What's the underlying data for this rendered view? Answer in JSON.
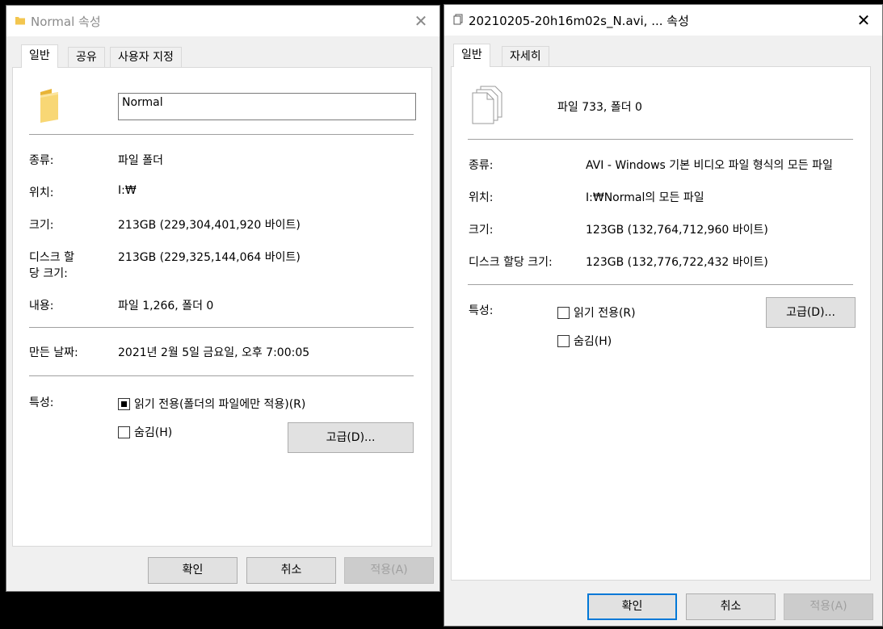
{
  "dialog1": {
    "title": "Normal 속성",
    "close_glyph": "✕",
    "tabs": [
      "일반",
      "공유",
      "사용자 지정"
    ],
    "name_value": "Normal",
    "rows": {
      "type_label": "종류:",
      "type_value": "파일 폴더",
      "location_label": "위치:",
      "location_value": "I:₩",
      "size_label": "크기:",
      "size_value": "213GB (229,304,401,920 바이트)",
      "disk_label_line1": "디스크 할",
      "disk_label_line2": "당 크기:",
      "disk_value": "213GB (229,325,144,064 바이트)",
      "contains_label": "내용:",
      "contains_value": "파일 1,266, 폴더 0",
      "created_label": "만든 날짜:",
      "created_value": "2021년 2월 5일 금요일, 오후 7:00:05",
      "attributes_label": "특성:"
    },
    "readonly_label": "읽기 전용(폴더의 파일에만 적용)(R)",
    "readonly_state": "indeterminate",
    "hidden_label": "숨김(H)",
    "hidden_state": "unchecked",
    "advanced_label": "고급(D)...",
    "ok_label": "확인",
    "cancel_label": "취소",
    "apply_label": "적용(A)"
  },
  "dialog2": {
    "title": "20210205-20h16m02s_N.avi, ... 속성",
    "close_glyph": "✕",
    "tabs": [
      "일반",
      "자세히"
    ],
    "summary": "파일 733, 폴더 0",
    "rows": {
      "type_label": "종류:",
      "type_value": "AVI - Windows 기본 비디오 파일 형식의 모든 파일",
      "location_label": "위치:",
      "location_value": "I:₩Normal의 모든 파일",
      "size_label": "크기:",
      "size_value": "123GB (132,764,712,960 바이트)",
      "disk_label": "디스크 할당 크기:",
      "disk_value": "123GB (132,776,722,432 바이트)",
      "attributes_label": "특성:"
    },
    "readonly_label": "읽기 전용(R)",
    "readonly_state": "unchecked",
    "hidden_label": "숨김(H)",
    "hidden_state": "unchecked",
    "advanced_label": "고급(D)...",
    "ok_label": "확인",
    "cancel_label": "취소",
    "apply_label": "적용(A)"
  },
  "colors": {
    "accent": "#0078d7",
    "folder": "#f8d775"
  },
  "icons": {
    "folder": "folder-icon",
    "files": "multiple-files-icon",
    "close": "close-icon"
  }
}
